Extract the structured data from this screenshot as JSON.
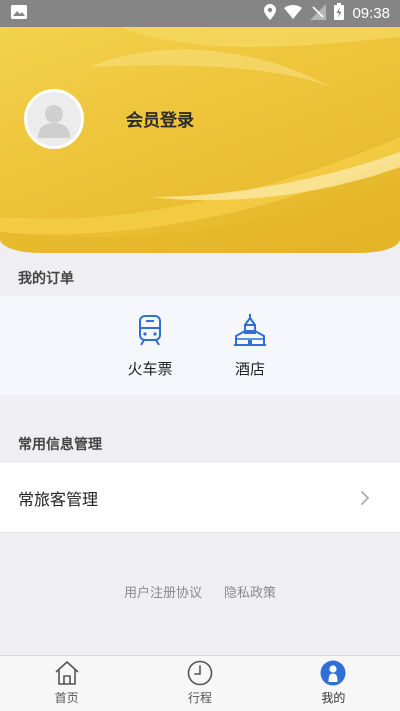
{
  "status_bar": {
    "time": "09:38",
    "icons": [
      "image-icon",
      "location-icon",
      "wifi-icon",
      "signal-icon",
      "battery-icon"
    ]
  },
  "profile": {
    "login_label": "会员登录"
  },
  "orders": {
    "section_title": "我的订单",
    "items": [
      {
        "label": "火车票",
        "icon": "train-icon"
      },
      {
        "label": "酒店",
        "icon": "hotel-icon"
      }
    ]
  },
  "info": {
    "section_title": "常用信息管理",
    "items": [
      {
        "label": "常旅客管理",
        "icon": "chevron-right-icon"
      }
    ]
  },
  "footer": {
    "links": [
      "用户注册协议",
      "隐私政策"
    ]
  },
  "tab_bar": {
    "tabs": [
      {
        "label": "首页",
        "icon": "home-icon",
        "active": false
      },
      {
        "label": "行程",
        "icon": "clock-icon",
        "active": false
      },
      {
        "label": "我的",
        "icon": "user-icon",
        "active": true
      }
    ]
  },
  "colors": {
    "header_yellow": "#eec53b",
    "accent_blue": "#2f6fd6",
    "status_bar_gray": "#858585"
  }
}
